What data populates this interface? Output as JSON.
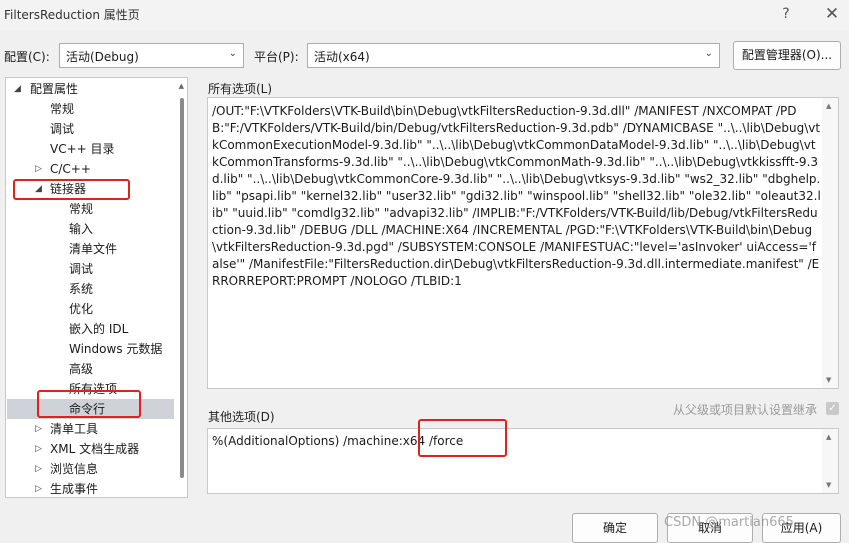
{
  "window": {
    "title": "FiltersReduction 属性页",
    "help_glyph": "?",
    "close_glyph": "✕"
  },
  "config": {
    "config_label": "配置(C):",
    "config_value": "活动(Debug)",
    "platform_label": "平台(P):",
    "platform_value": "活动(x64)",
    "manager_button": "配置管理器(O)..."
  },
  "tree": {
    "root": "配置属性",
    "items": [
      "常规",
      "调试",
      "VC++ 目录",
      "C/C++",
      "链接器"
    ],
    "linker_children": [
      "常规",
      "输入",
      "清单文件",
      "调试",
      "系统",
      "优化",
      "嵌入的 IDL",
      "Windows 元数据",
      "高级",
      "所有选项",
      "命令行"
    ],
    "tail_items": [
      "清单工具",
      "XML 文档生成器",
      "浏览信息",
      "生成事件"
    ],
    "selected": "命令行"
  },
  "all_options": {
    "label": "所有选项(L)",
    "text": "/OUT:\"F:\\VTKFolders\\VTK-Build\\bin\\Debug\\vtkFiltersReduction-9.3d.dll\" /MANIFEST /NXCOMPAT /PDB:\"F:/VTKFolders/VTK-Build/bin/Debug/vtkFiltersReduction-9.3d.pdb\" /DYNAMICBASE \"..\\..\\lib\\Debug\\vtkCommonExecutionModel-9.3d.lib\" \"..\\..\\lib\\Debug\\vtkCommonDataModel-9.3d.lib\" \"..\\..\\lib\\Debug\\vtkCommonTransforms-9.3d.lib\" \"..\\..\\lib\\Debug\\vtkCommonMath-9.3d.lib\" \"..\\..\\lib\\Debug\\vtkkissfft-9.3d.lib\" \"..\\..\\lib\\Debug\\vtkCommonCore-9.3d.lib\" \"..\\..\\lib\\Debug\\vtksys-9.3d.lib\" \"ws2_32.lib\" \"dbghelp.lib\" \"psapi.lib\" \"kernel32.lib\" \"user32.lib\" \"gdi32.lib\" \"winspool.lib\" \"shell32.lib\" \"ole32.lib\" \"oleaut32.lib\" \"uuid.lib\" \"comdlg32.lib\" \"advapi32.lib\" /IMPLIB:\"F:/VTKFolders/VTK-Build/lib/Debug/vtkFiltersReduction-9.3d.lib\" /DEBUG /DLL /MACHINE:X64 /INCREMENTAL /PGD:\"F:\\VTKFolders\\VTK-Build\\bin\\Debug\\vtkFiltersReduction-9.3d.pgd\" /SUBSYSTEM:CONSOLE /MANIFESTUAC:\"level='asInvoker' uiAccess='false'\" /ManifestFile:\"FiltersReduction.dir\\Debug\\vtkFiltersReduction-9.3d.dll.intermediate.manifest\" /ERRORREPORT:PROMPT /NOLOGO /TLBID:1"
  },
  "other_options": {
    "label": "其他选项(D)",
    "text": "%(AdditionalOptions) /machine:x64 /force",
    "inherit_label": "从父级或项目默认设置继承"
  },
  "buttons": {
    "ok": "确定",
    "cancel": "取消",
    "apply": "应用(A)"
  },
  "watermark": "CSDN @martian665",
  "colors": {
    "highlight_red": "#e0221f",
    "selected_bg": "#cfd3d9"
  }
}
